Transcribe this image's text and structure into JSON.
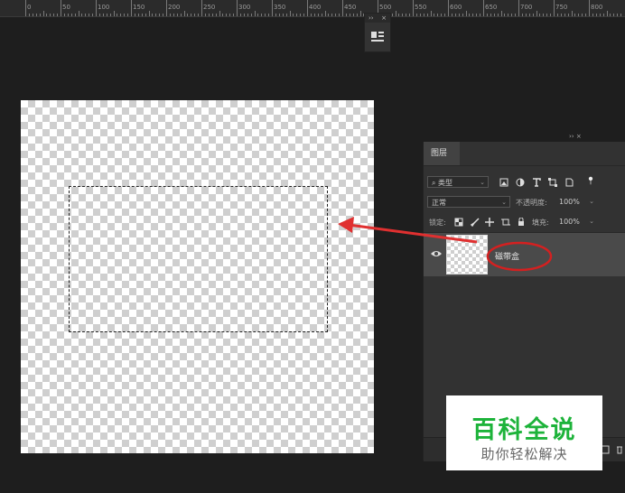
{
  "ruler": {
    "labels": [
      "0",
      "50",
      "100",
      "150",
      "200",
      "250",
      "300",
      "350",
      "400",
      "450",
      "500",
      "550",
      "600",
      "650",
      "700",
      "750",
      "800"
    ]
  },
  "mini_panel": {
    "collapse": "››",
    "close": "×"
  },
  "layers_panel": {
    "collapse": "›› ×",
    "tab_label": "图层",
    "filter": {
      "search_glyph": "⌕",
      "value": "类型"
    },
    "blend_mode": "正常",
    "opacity_label": "不透明度:",
    "opacity_value": "100%",
    "lock_label": "锁定:",
    "fill_label": "填充:",
    "fill_value": "100%",
    "layers": [
      {
        "name": "磁带盒",
        "visible": true
      }
    ]
  },
  "annotations": {
    "arrow_color": "#e03030",
    "ellipse_color": "#d42020"
  },
  "watermark": {
    "title": "百科全说",
    "subtitle": "助你轻松解决",
    "title_color": "#1db33a"
  }
}
